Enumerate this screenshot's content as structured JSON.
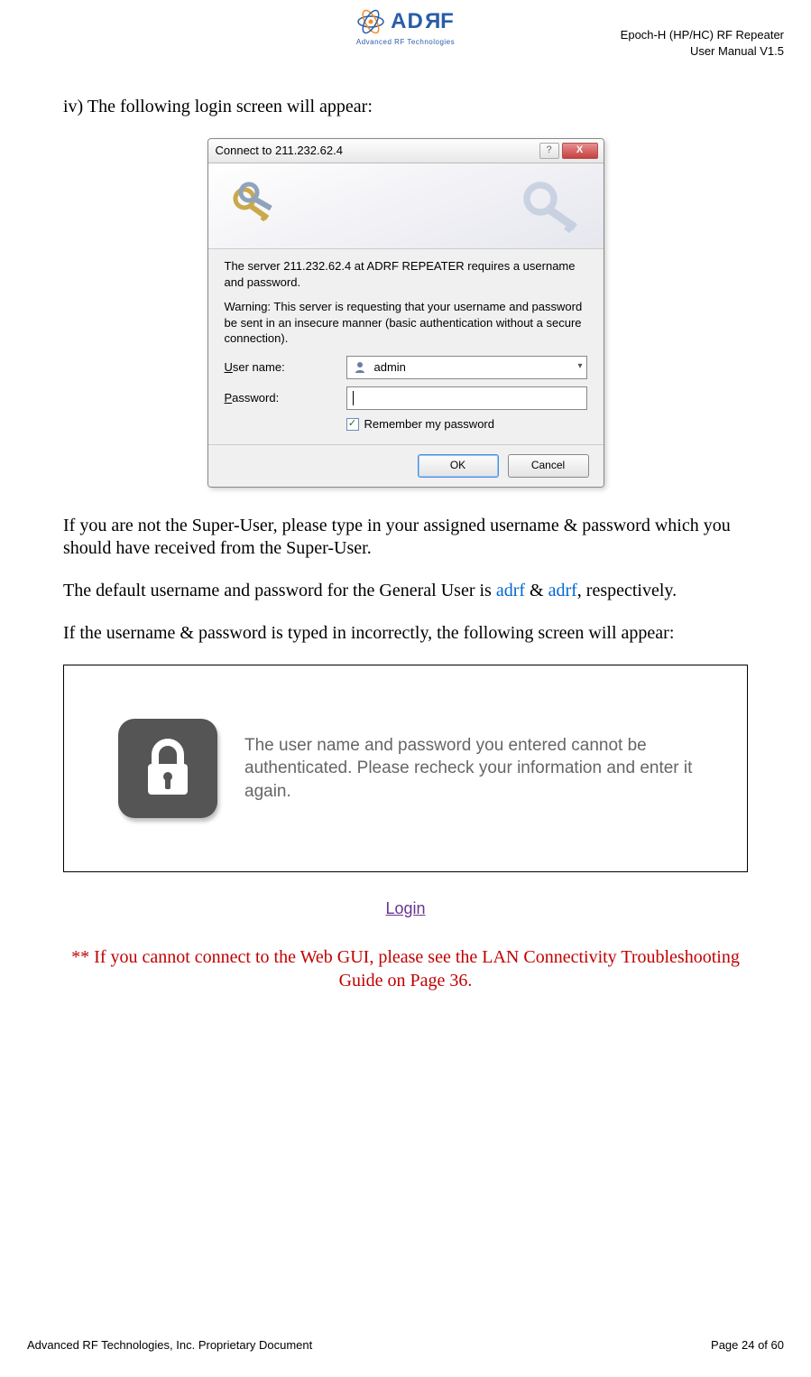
{
  "header": {
    "logo_text": "AD",
    "logo_text2": "F",
    "logo_subtitle": "Advanced RF Technologies",
    "title_line1": "Epoch-H (HP/HC) RF Repeater",
    "title_line2": "User Manual V1.5"
  },
  "body": {
    "intro": "iv) The following login screen will appear:",
    "after_dialog_p1": "If you are not the Super-User, please type in your assigned username & password which you should have received from the Super-User.",
    "after_dialog_p2a": "The default username and password for the General User is ",
    "after_dialog_p2_blue1": "adrf",
    "after_dialog_p2_amp": " & ",
    "after_dialog_p2_blue2": "adrf",
    "after_dialog_p2b": ", respectively.",
    "after_dialog_p3": "If the username & password is typed in incorrectly, the following screen will appear:"
  },
  "dialog": {
    "title": "Connect to 211.232.62.4",
    "msg1": "The server 211.232.62.4 at ADRF REPEATER requires a username and password.",
    "msg2": "Warning: This server is requesting that your username and password be sent in an insecure manner (basic authentication without a secure connection).",
    "username_label_pre": "",
    "username_accel": "U",
    "username_label_post": "ser name:",
    "password_accel": "P",
    "password_label_post": "assword:",
    "username_value": "admin",
    "remember_accel": "R",
    "remember_label_post": "emember my password",
    "ok": "OK",
    "cancel": "Cancel"
  },
  "error_box": {
    "text": "The user name and password you entered cannot be authenticated. Please recheck your information and enter it again."
  },
  "login_link": "Login",
  "red_note": "** If you cannot connect to the Web GUI, please see the LAN Connectivity Troubleshooting Guide on Page 36.",
  "footer": {
    "left": "Advanced RF Technologies, Inc. Proprietary Document",
    "right": "Page 24 of 60"
  }
}
